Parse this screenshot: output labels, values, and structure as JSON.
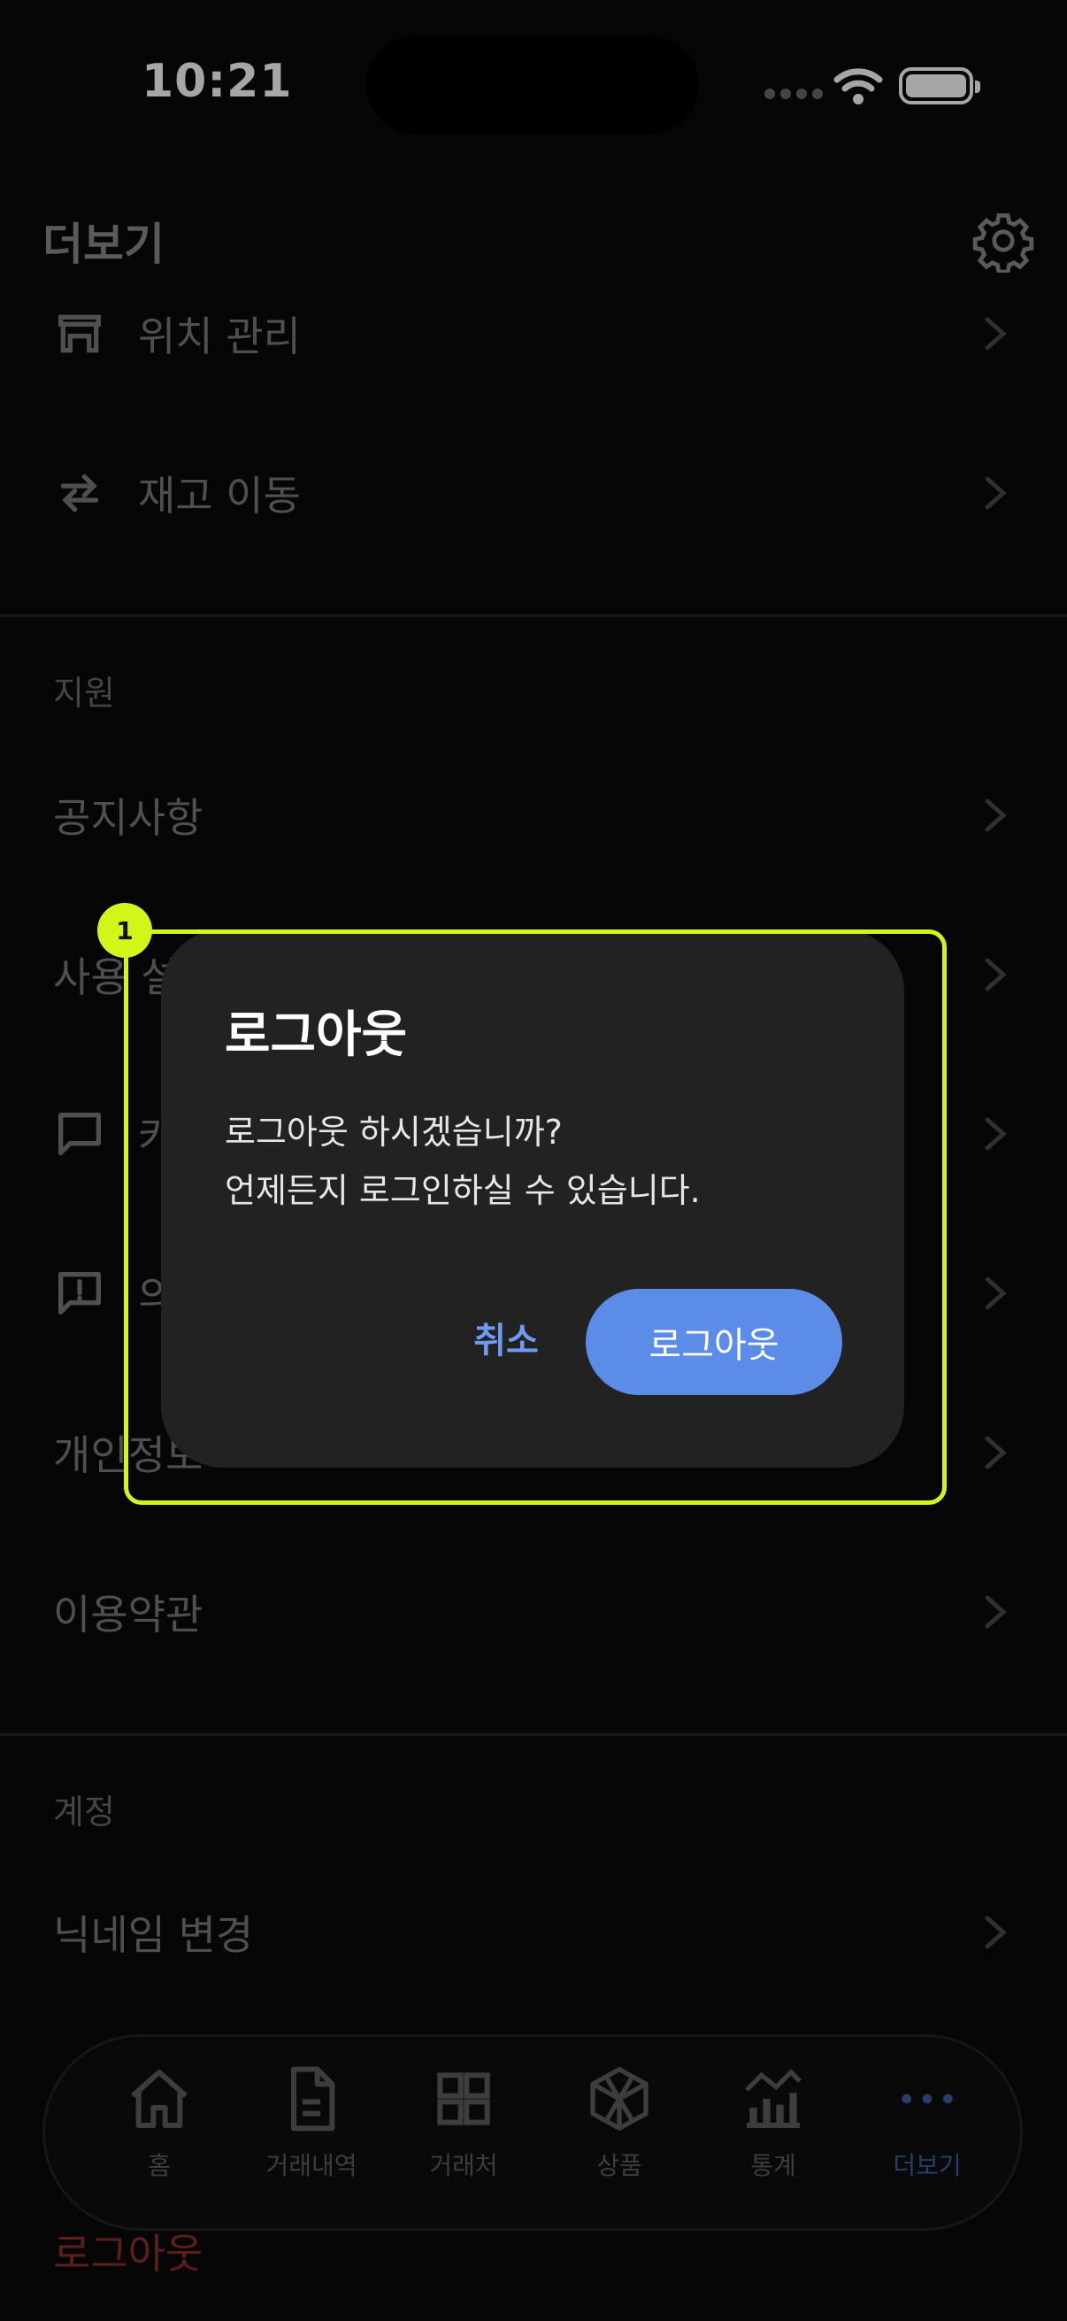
{
  "status_bar": {
    "time": "10:21"
  },
  "header": {
    "title": "더보기"
  },
  "inventory_items": [
    {
      "label": "위치 관리",
      "icon": "store-icon"
    },
    {
      "label": "재고 이동",
      "icon": "swap-arrows-icon"
    }
  ],
  "support": {
    "section_title": "지원",
    "items": [
      {
        "label": "공지사항"
      },
      {
        "label": "사용 설"
      },
      {
        "label": "카",
        "icon": "chat-icon"
      },
      {
        "label": "의",
        "icon": "chat-alert-icon"
      },
      {
        "label": "개인정보"
      },
      {
        "label": "이용약관"
      }
    ]
  },
  "account": {
    "section_title": "계정",
    "items": [
      {
        "label": "닉네임 변경"
      }
    ],
    "logout_label": "로그아웃"
  },
  "dialog": {
    "title": "로그아웃",
    "message_line1": "로그아웃 하시겠습니까?",
    "message_line2": "언제든지 로그인하실 수 있습니다.",
    "cancel_label": "취소",
    "confirm_label": "로그아웃"
  },
  "highlight": {
    "badge": "1"
  },
  "tabbar": {
    "tabs": [
      {
        "label": "홈",
        "icon": "home-icon"
      },
      {
        "label": "거래내역",
        "icon": "document-icon"
      },
      {
        "label": "거래처",
        "icon": "grid-icon"
      },
      {
        "label": "상품",
        "icon": "cube-icon"
      },
      {
        "label": "통계",
        "icon": "chart-icon"
      },
      {
        "label": "더보기",
        "icon": "more-dots-icon",
        "active": true
      }
    ],
    "active_color": "#3c5fa6"
  },
  "colors": {
    "accent": "#5b8de8",
    "highlight": "#d4f51a",
    "danger": "#8e2f2a"
  }
}
